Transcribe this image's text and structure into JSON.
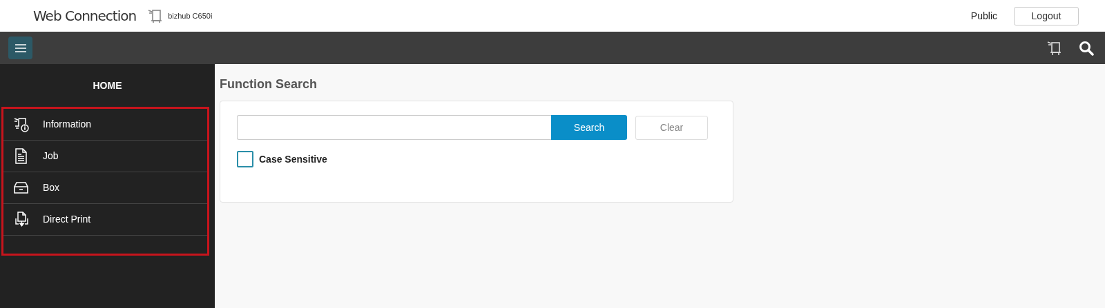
{
  "header": {
    "app_title": "Web Connection",
    "device_name": "bizhub C650i",
    "user": "Public",
    "logout_button": "Logout"
  },
  "sidebar": {
    "heading": "HOME",
    "items": [
      {
        "label": "Information"
      },
      {
        "label": "Job"
      },
      {
        "label": "Box"
      },
      {
        "label": "Direct Print"
      }
    ]
  },
  "function_search": {
    "title": "Function Search",
    "search_button": "Search",
    "clear_button": "Clear",
    "case_sensitive": {
      "label": "Case Sensitive",
      "checked": false
    }
  }
}
